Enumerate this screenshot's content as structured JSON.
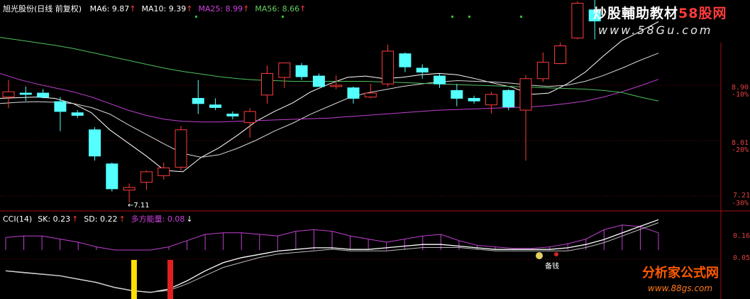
{
  "chart_data": [
    {
      "type": "candlestick",
      "header": {
        "title": "旭光股份(日线 前复权)",
        "indicators": [
          {
            "label": "MA6",
            "value": "9.87",
            "color": "#ffffff"
          },
          {
            "label": "MA10",
            "value": "9.39",
            "color": "#ffffff"
          },
          {
            "label": "MA25",
            "value": "8.99",
            "color": "#d040e0"
          },
          {
            "label": "MA56",
            "value": "8.66",
            "color": "#60d060"
          }
        ]
      },
      "y_ticks": [
        {
          "price": "8.90",
          "pct": "-10%"
        },
        {
          "price": "8.01",
          "pct": "-20%"
        },
        {
          "price": "7.21",
          "pct": "-30%"
        }
      ],
      "low_annotation": "←7.11",
      "candles": [
        {
          "o": 8.72,
          "h": 8.98,
          "l": 8.55,
          "c": 8.8
        },
        {
          "o": 8.78,
          "h": 8.88,
          "l": 8.66,
          "c": 8.76
        },
        {
          "o": 8.78,
          "h": 8.84,
          "l": 8.7,
          "c": 8.72
        },
        {
          "o": 8.65,
          "h": 8.72,
          "l": 8.2,
          "c": 8.5
        },
        {
          "o": 8.48,
          "h": 8.52,
          "l": 8.4,
          "c": 8.44
        },
        {
          "o": 8.22,
          "h": 8.26,
          "l": 7.75,
          "c": 7.82
        },
        {
          "o": 7.7,
          "h": 7.72,
          "l": 7.28,
          "c": 7.32
        },
        {
          "o": 7.3,
          "h": 7.4,
          "l": 7.11,
          "c": 7.34
        },
        {
          "o": 7.42,
          "h": 7.6,
          "l": 7.3,
          "c": 7.58
        },
        {
          "o": 7.52,
          "h": 7.72,
          "l": 7.46,
          "c": 7.64
        },
        {
          "o": 7.65,
          "h": 8.28,
          "l": 7.6,
          "c": 8.22
        },
        {
          "o": 8.7,
          "h": 8.98,
          "l": 8.46,
          "c": 8.62
        },
        {
          "o": 8.6,
          "h": 8.7,
          "l": 8.52,
          "c": 8.56
        },
        {
          "o": 8.46,
          "h": 8.5,
          "l": 8.38,
          "c": 8.43
        },
        {
          "o": 8.33,
          "h": 8.55,
          "l": 8.1,
          "c": 8.5
        },
        {
          "o": 8.75,
          "h": 9.2,
          "l": 8.62,
          "c": 9.08
        },
        {
          "o": 9.02,
          "h": 9.24,
          "l": 8.86,
          "c": 9.24
        },
        {
          "o": 9.2,
          "h": 9.24,
          "l": 8.98,
          "c": 9.03
        },
        {
          "o": 9.04,
          "h": 9.08,
          "l": 8.88,
          "c": 8.88
        },
        {
          "o": 8.88,
          "h": 9.05,
          "l": 8.84,
          "c": 8.9
        },
        {
          "o": 8.86,
          "h": 8.88,
          "l": 8.62,
          "c": 8.7
        },
        {
          "o": 8.72,
          "h": 8.92,
          "l": 8.7,
          "c": 8.78
        },
        {
          "o": 8.92,
          "h": 9.52,
          "l": 8.88,
          "c": 9.42
        },
        {
          "o": 9.38,
          "h": 9.4,
          "l": 9.1,
          "c": 9.18
        },
        {
          "o": 9.16,
          "h": 9.22,
          "l": 9.0,
          "c": 9.1
        },
        {
          "o": 9.04,
          "h": 9.08,
          "l": 8.86,
          "c": 8.92
        },
        {
          "o": 8.82,
          "h": 8.92,
          "l": 8.58,
          "c": 8.7
        },
        {
          "o": 8.7,
          "h": 8.74,
          "l": 8.62,
          "c": 8.66
        },
        {
          "o": 8.6,
          "h": 8.8,
          "l": 8.47,
          "c": 8.76
        },
        {
          "o": 8.82,
          "h": 8.84,
          "l": 8.52,
          "c": 8.57
        },
        {
          "o": 8.52,
          "h": 9.05,
          "l": 7.75,
          "c": 9.0
        },
        {
          "o": 9.0,
          "h": 9.4,
          "l": 8.95,
          "c": 9.25
        },
        {
          "o": 9.23,
          "h": 9.55,
          "l": 9.22,
          "c": 9.5
        },
        {
          "o": 9.62,
          "h": 10.18,
          "l": 9.6,
          "c": 10.15
        },
        {
          "o": 10.05,
          "h": 10.6,
          "l": 9.6,
          "c": 9.88
        }
      ],
      "series": [
        {
          "name": "MA6",
          "color": "#ffffff",
          "values": [
            8.7,
            8.71,
            8.72,
            8.7,
            8.62,
            8.48,
            8.22,
            8.02,
            7.82,
            7.6,
            7.58,
            7.8,
            7.95,
            8.14,
            8.35,
            8.5,
            8.63,
            8.8,
            8.92,
            9.02,
            9.04,
            9.0,
            9.02,
            9.06,
            9.08,
            9.06,
            9.0,
            8.93,
            8.87,
            8.76,
            8.78,
            8.92,
            9.1,
            9.35,
            9.58,
            9.72,
            9.87
          ]
        },
        {
          "name": "MA10",
          "color": "#d8d8d8",
          "values": [
            8.62,
            8.64,
            8.65,
            8.64,
            8.62,
            8.56,
            8.46,
            8.3,
            8.15,
            8.0,
            7.86,
            7.8,
            7.84,
            7.94,
            8.06,
            8.2,
            8.32,
            8.46,
            8.58,
            8.7,
            8.78,
            8.83,
            8.88,
            8.92,
            8.95,
            8.97,
            8.96,
            8.95,
            8.93,
            8.9,
            8.88,
            8.9,
            8.96,
            9.05,
            9.16,
            9.28,
            9.39
          ]
        },
        {
          "name": "MA25",
          "color": "#c040d0",
          "values": [
            9.08,
            8.99,
            8.92,
            8.86,
            8.8,
            8.72,
            8.62,
            8.52,
            8.44,
            8.38,
            8.35,
            8.34,
            8.34,
            8.35,
            8.36,
            8.37,
            8.38,
            8.39,
            8.4,
            8.42,
            8.44,
            8.46,
            8.48,
            8.5,
            8.52,
            8.53,
            8.54,
            8.55,
            8.56,
            8.57,
            8.59,
            8.62,
            8.66,
            8.72,
            8.8,
            8.89,
            8.99
          ]
        },
        {
          "name": "MA56",
          "color": "#50c060",
          "values": [
            9.63,
            9.59,
            9.55,
            9.51,
            9.46,
            9.4,
            9.34,
            9.28,
            9.22,
            9.16,
            9.11,
            9.07,
            9.03,
            9.0,
            8.98,
            8.97,
            8.96,
            8.96,
            8.96,
            8.96,
            8.96,
            8.95,
            8.94,
            8.93,
            8.92,
            8.91,
            8.9,
            8.89,
            8.88,
            8.87,
            8.86,
            8.85,
            8.84,
            8.82,
            8.79,
            8.72,
            8.66
          ]
        }
      ]
    },
    {
      "type": "line",
      "header": {
        "indicators": [
          {
            "label": "CCI(14)",
            "value": "",
            "color": "#ffffff"
          },
          {
            "label": "SK",
            "value": "0.23",
            "color": "#ffffff"
          },
          {
            "label": "SD",
            "value": "0.22",
            "color": "#ffffff"
          },
          {
            "label": "多方能量",
            "value": "0.08",
            "color": "#d040e0"
          }
        ]
      },
      "y_ticks": [
        "0.16",
        "0.05"
      ],
      "sk": [
        -0.08,
        -0.09,
        -0.1,
        -0.11,
        -0.13,
        -0.15,
        -0.18,
        -0.2,
        -0.21,
        -0.19,
        -0.14,
        -0.08,
        -0.03,
        0.0,
        0.02,
        0.04,
        0.05,
        0.06,
        0.06,
        0.05,
        0.05,
        0.06,
        0.07,
        0.08,
        0.08,
        0.07,
        0.06,
        0.05,
        0.05,
        0.05,
        0.05,
        0.06,
        0.08,
        0.11,
        0.15,
        0.19,
        0.23
      ],
      "sd": [
        -0.07,
        -0.08,
        -0.09,
        -0.1,
        -0.12,
        -0.14,
        -0.17,
        -0.19,
        -0.2,
        -0.19,
        -0.15,
        -0.1,
        -0.05,
        -0.02,
        0.01,
        0.03,
        0.04,
        0.05,
        0.06,
        0.05,
        0.05,
        0.05,
        0.06,
        0.07,
        0.07,
        0.07,
        0.06,
        0.05,
        0.05,
        0.05,
        0.05,
        0.05,
        0.07,
        0.1,
        0.14,
        0.18,
        0.22
      ],
      "energy": [
        0.08,
        0.09,
        0.09,
        0.07,
        0.05,
        0.02,
        0.0,
        0.0,
        0.0,
        0.02,
        0.06,
        0.1,
        0.11,
        0.11,
        0.1,
        0.09,
        0.12,
        0.13,
        0.12,
        0.09,
        0.07,
        0.05,
        0.07,
        0.09,
        0.1,
        0.06,
        0.03,
        0.02,
        0.01,
        0.01,
        0.02,
        0.04,
        0.07,
        0.13,
        0.16,
        0.15,
        0.11
      ],
      "signals": [
        {
          "index": 7,
          "color": "#ffe000"
        },
        {
          "index": 9,
          "color": "#e02020"
        }
      ],
      "note_label": "备钱",
      "ylim": [
        -0.25,
        0.27
      ]
    }
  ],
  "watermark": {
    "site_a": "炒股輔助教材",
    "site_a_red": "58股网",
    "site_a_url": "www.58Gu.com",
    "site_b": "分析家公式网",
    "site_b_url": "www.88gs.com"
  }
}
